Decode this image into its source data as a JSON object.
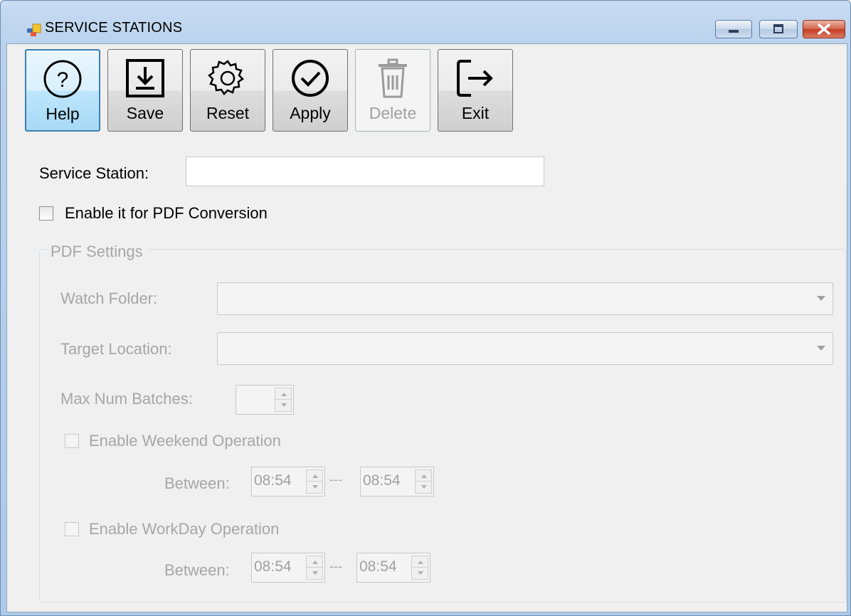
{
  "window": {
    "title": "SERVICE  STATIONS"
  },
  "toolbar": {
    "help_label": "Help",
    "save_label": "Save",
    "reset_label": "Reset",
    "apply_label": "Apply",
    "delete_label": "Delete",
    "exit_label": "Exit"
  },
  "form": {
    "service_station_label": "Service Station:",
    "service_station_value": "",
    "enable_pdf_label": "Enable it for PDF Conversion",
    "enable_pdf_checked": false
  },
  "pdf_settings": {
    "title": "PDF Settings",
    "watch_folder_label": "Watch Folder:",
    "watch_folder_value": "",
    "target_location_label": "Target Location:",
    "target_location_value": "",
    "max_batches_label": "Max Num Batches:",
    "max_batches_value": "",
    "weekend": {
      "label": "Enable Weekend Operation",
      "checked": false,
      "between_label": "Between:",
      "from": "08:54",
      "separator": "---",
      "to": "08:54"
    },
    "workday": {
      "label": "Enable WorkDay Operation",
      "checked": false,
      "between_label": "Between:",
      "from": "08:54",
      "separator": "---",
      "to": "08:54"
    }
  },
  "colors": {
    "focus_border": "#3c7fb1",
    "disabled_text": "#a6a6a6",
    "close_button": "#c33a22"
  },
  "icons": [
    "app-icon",
    "help-icon",
    "save-icon",
    "reset-icon",
    "apply-icon",
    "delete-icon",
    "exit-icon"
  ]
}
